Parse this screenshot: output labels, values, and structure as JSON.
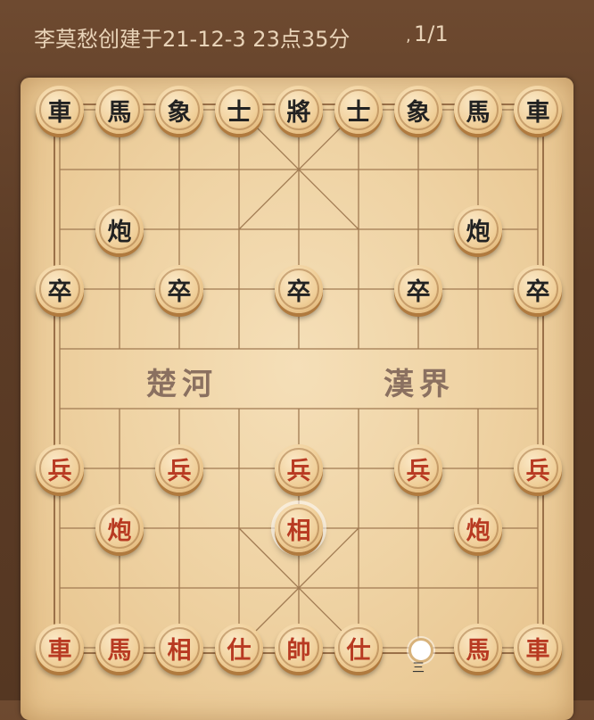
{
  "header": {
    "title": "李莫愁创建于21-12-3 23点35分",
    "separator": ",",
    "page": "1/1"
  },
  "board": {
    "river_left": "楚河",
    "river_right": "漢界",
    "hint_label": "三"
  },
  "colors": {
    "black_piece_text": "#222222",
    "red_piece_text": "#b83a22",
    "board": "#efd3a4"
  },
  "pieces": [
    {
      "char": "車",
      "side": "black",
      "col": 0,
      "row": 0
    },
    {
      "char": "馬",
      "side": "black",
      "col": 1,
      "row": 0
    },
    {
      "char": "象",
      "side": "black",
      "col": 2,
      "row": 0
    },
    {
      "char": "士",
      "side": "black",
      "col": 3,
      "row": 0
    },
    {
      "char": "將",
      "side": "black",
      "col": 4,
      "row": 0
    },
    {
      "char": "士",
      "side": "black",
      "col": 5,
      "row": 0
    },
    {
      "char": "象",
      "side": "black",
      "col": 6,
      "row": 0
    },
    {
      "char": "馬",
      "side": "black",
      "col": 7,
      "row": 0
    },
    {
      "char": "車",
      "side": "black",
      "col": 8,
      "row": 0
    },
    {
      "char": "炮",
      "side": "black",
      "col": 1,
      "row": 2
    },
    {
      "char": "炮",
      "side": "black",
      "col": 7,
      "row": 2
    },
    {
      "char": "卒",
      "side": "black",
      "col": 0,
      "row": 3
    },
    {
      "char": "卒",
      "side": "black",
      "col": 2,
      "row": 3
    },
    {
      "char": "卒",
      "side": "black",
      "col": 4,
      "row": 3
    },
    {
      "char": "卒",
      "side": "black",
      "col": 6,
      "row": 3
    },
    {
      "char": "卒",
      "side": "black",
      "col": 8,
      "row": 3
    },
    {
      "char": "兵",
      "side": "red",
      "col": 0,
      "row": 6
    },
    {
      "char": "兵",
      "side": "red",
      "col": 2,
      "row": 6
    },
    {
      "char": "兵",
      "side": "red",
      "col": 4,
      "row": 6
    },
    {
      "char": "兵",
      "side": "red",
      "col": 6,
      "row": 6
    },
    {
      "char": "兵",
      "side": "red",
      "col": 8,
      "row": 6
    },
    {
      "char": "炮",
      "side": "red",
      "col": 1,
      "row": 7
    },
    {
      "char": "相",
      "side": "red",
      "col": 4,
      "row": 7,
      "selected": true
    },
    {
      "char": "炮",
      "side": "red",
      "col": 7,
      "row": 7
    },
    {
      "char": "車",
      "side": "red",
      "col": 0,
      "row": 9
    },
    {
      "char": "馬",
      "side": "red",
      "col": 1,
      "row": 9
    },
    {
      "char": "相",
      "side": "red",
      "col": 2,
      "row": 9
    },
    {
      "char": "仕",
      "side": "red",
      "col": 3,
      "row": 9
    },
    {
      "char": "帥",
      "side": "red",
      "col": 4,
      "row": 9
    },
    {
      "char": "仕",
      "side": "red",
      "col": 5,
      "row": 9
    },
    {
      "char": "馬",
      "side": "red",
      "col": 7,
      "row": 9
    },
    {
      "char": "車",
      "side": "red",
      "col": 8,
      "row": 9
    }
  ],
  "move_hint": {
    "col": 6,
    "row": 9
  }
}
